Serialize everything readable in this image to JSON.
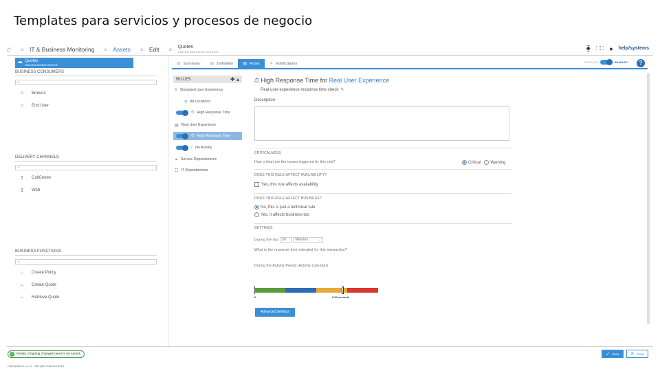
{
  "slide_title": "Templates para servicios y procesos de negocio",
  "breadcrumb": {
    "items": [
      "IT & Business Monitoring",
      "Assets",
      "Edit"
    ],
    "current": "Quotes",
    "current_sub": "ONLINE BUSINESS SERVICE"
  },
  "brand": {
    "logo": "help/systems"
  },
  "left": {
    "selected": {
      "title": "Quotes",
      "sub": "ONLINE BUSINESS SERVICE"
    },
    "consumers": {
      "title": "BUSINESS CONSUMERS",
      "filter": "%",
      "items": [
        "Brokers",
        "End User"
      ]
    },
    "channels": {
      "title": "DELIVERY CHANNELS",
      "filter": "%",
      "items": [
        "CallCenter",
        "Web"
      ]
    },
    "functions": {
      "title": "BUSINESS FUNCTIONS",
      "filter": "%",
      "items": [
        "Create Policy",
        "Create Quote",
        "Retrieve Quote"
      ]
    }
  },
  "tabs": [
    "Summary",
    "Definition",
    "Rules",
    "Notifications"
  ],
  "enabled_toggle": {
    "off": "DISABLED",
    "on": "ENABLED"
  },
  "help": "?",
  "rules": {
    "header": "RULES",
    "items": [
      "Simulated User Experience",
      "All Locations",
      "High Response Time",
      "Real User Experience",
      "High Response Time",
      "No Activity",
      "Service Dependencies",
      "IT Dependencies"
    ]
  },
  "detail": {
    "title_prefix": "High Response Time for ",
    "title_link": "Real User Experience",
    "subtitle": "Real user experience response time check",
    "description_label": "Description",
    "criticalness": {
      "title": "CRITICALNESS",
      "question": "How critical are the issues triggered by this rule?",
      "options": [
        "Critical",
        "Warning"
      ],
      "selected": "Critical"
    },
    "availability": {
      "title": "DOES THIS RULE AFFECT AVAILABILITY?",
      "option": "Yes, this rule affects availability"
    },
    "business": {
      "title": "DOES THIS RULE AFFECT BUSINESS?",
      "options": [
        "No, this is just a technical rule",
        "Yes, it affects business too"
      ]
    },
    "settings": {
      "title": "SETTINGS",
      "during_label": "During the last",
      "during_value": "30",
      "unit": "Minutes",
      "question": "What is the response time tolerated for this transaction?",
      "period": "During the Activity Period (Activity Calendar)",
      "scale_start": "0",
      "scale_mark": "5.00 seconds",
      "colors": [
        "#5a9e3c",
        "#2e6db4",
        "#e8a93c",
        "#d9382f"
      ]
    },
    "advanced_button": "Advanced Settings"
  },
  "footer": {
    "status": "Ready. Ongoing changes need to be saved.",
    "save": "Save",
    "close": "Close",
    "copyright": "HelpSystems, L.L.C. - All rights reserved 2016."
  }
}
